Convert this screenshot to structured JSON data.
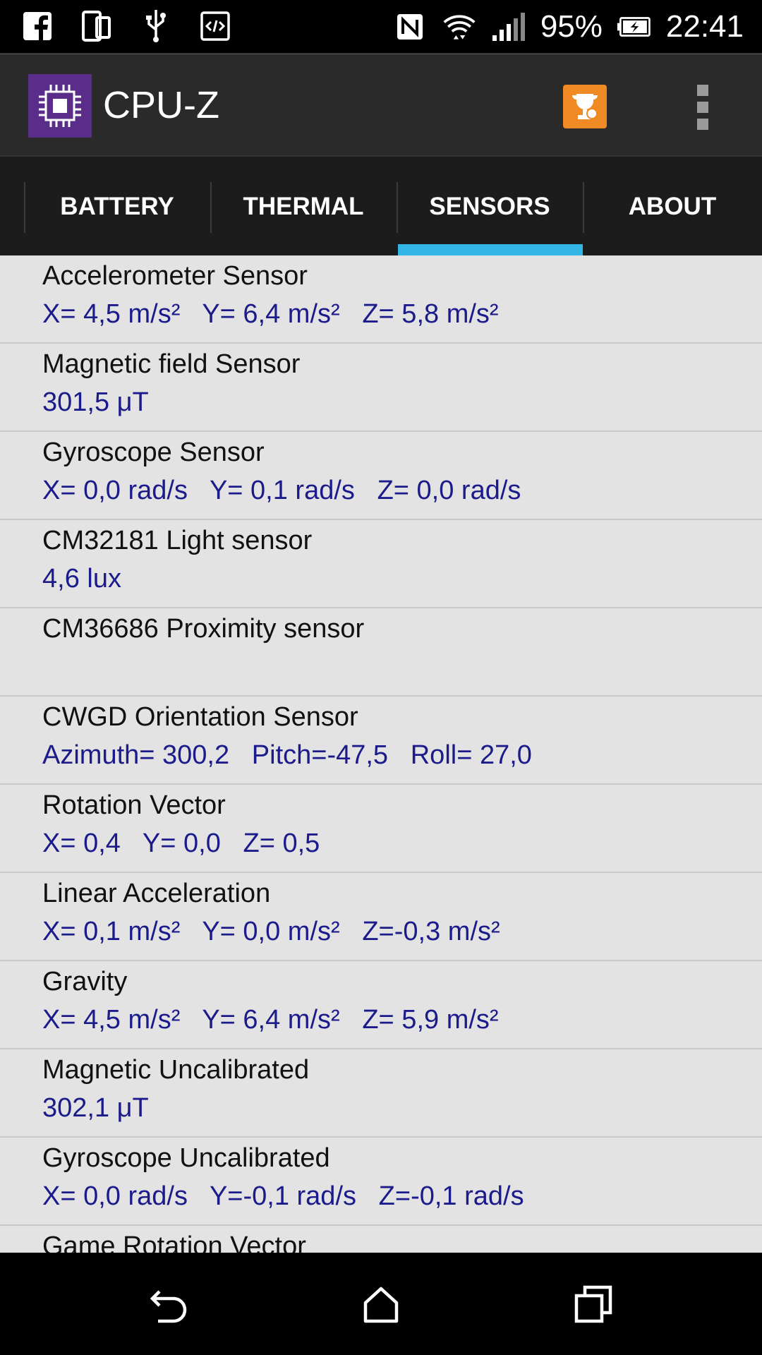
{
  "status_bar": {
    "left_icons": [
      "facebook-icon",
      "dual-screen-icon",
      "usb-icon",
      "code-icon"
    ],
    "right_icons": [
      "nfc-icon",
      "wifi-icon",
      "cell-signal-icon",
      "battery-charging-icon"
    ],
    "battery_percent": "95%",
    "time": "22:41"
  },
  "app_bar": {
    "title": "CPU-Z",
    "logo_icon": "cpu-chip-icon",
    "action_icon": "trophy-icon",
    "menu_icon": "overflow-menu-icon",
    "logo_color": "#5a2d8a",
    "action_color": "#f08a24"
  },
  "tabs": [
    {
      "label": "BATTERY"
    },
    {
      "label": "THERMAL"
    },
    {
      "label": "SENSORS",
      "selected": true
    },
    {
      "label": "ABOUT"
    }
  ],
  "accent_color": "#33b5e5",
  "sensors": [
    {
      "name": "Accelerometer Sensor",
      "value": "X= 4,5 m/s²   Y= 6,4 m/s²   Z= 5,8 m/s²"
    },
    {
      "name": "Magnetic field Sensor",
      "value": "301,5 μT"
    },
    {
      "name": "Gyroscope Sensor",
      "value": "X= 0,0 rad/s   Y= 0,1 rad/s   Z= 0,0 rad/s"
    },
    {
      "name": "CM32181 Light sensor",
      "value": "4,6 lux"
    },
    {
      "name": "CM36686 Proximity sensor",
      "value": ""
    },
    {
      "name": "CWGD Orientation Sensor",
      "value": "Azimuth= 300,2   Pitch=-47,5   Roll= 27,0"
    },
    {
      "name": "Rotation Vector",
      "value": "X= 0,4   Y= 0,0   Z= 0,5"
    },
    {
      "name": "Linear Acceleration",
      "value": "X= 0,1 m/s²   Y= 0,0 m/s²   Z=-0,3 m/s²"
    },
    {
      "name": "Gravity",
      "value": "X= 4,5 m/s²   Y= 6,4 m/s²   Z= 5,9 m/s²"
    },
    {
      "name": "Magnetic Uncalibrated",
      "value": "302,1 μT"
    },
    {
      "name": "Gyroscope Uncalibrated",
      "value": "X= 0,0 rad/s   Y=-0,1 rad/s   Z=-0,1 rad/s"
    },
    {
      "name": "Game Rotation Vector",
      "value": ""
    }
  ],
  "nav_bar": {
    "icons": [
      "back-icon",
      "home-icon",
      "recents-icon"
    ]
  }
}
